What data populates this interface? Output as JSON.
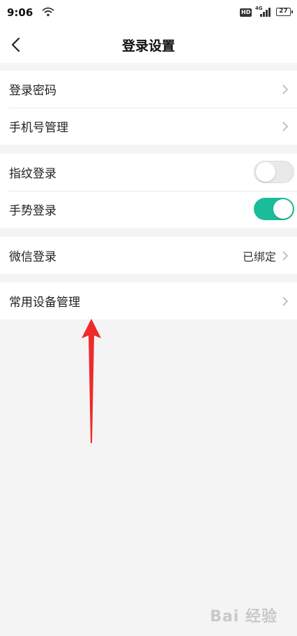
{
  "status_bar": {
    "time": "9:06",
    "hd": "HD",
    "network": "4G",
    "battery": "27"
  },
  "nav": {
    "title": "登录设置"
  },
  "groups": [
    {
      "rows": [
        {
          "label": "登录密码",
          "type": "link"
        },
        {
          "label": "手机号管理",
          "type": "link"
        }
      ]
    },
    {
      "rows": [
        {
          "label": "指纹登录",
          "type": "toggle",
          "on": false
        },
        {
          "label": "手势登录",
          "type": "toggle",
          "on": true
        }
      ]
    },
    {
      "rows": [
        {
          "label": "微信登录",
          "type": "link",
          "value": "已绑定"
        }
      ]
    },
    {
      "rows": [
        {
          "label": "常用设备管理",
          "type": "link"
        }
      ]
    }
  ],
  "colors": {
    "accent": "#1abc9c",
    "annotation_arrow": "#ee2a2a"
  },
  "watermark": "Bai 经验"
}
